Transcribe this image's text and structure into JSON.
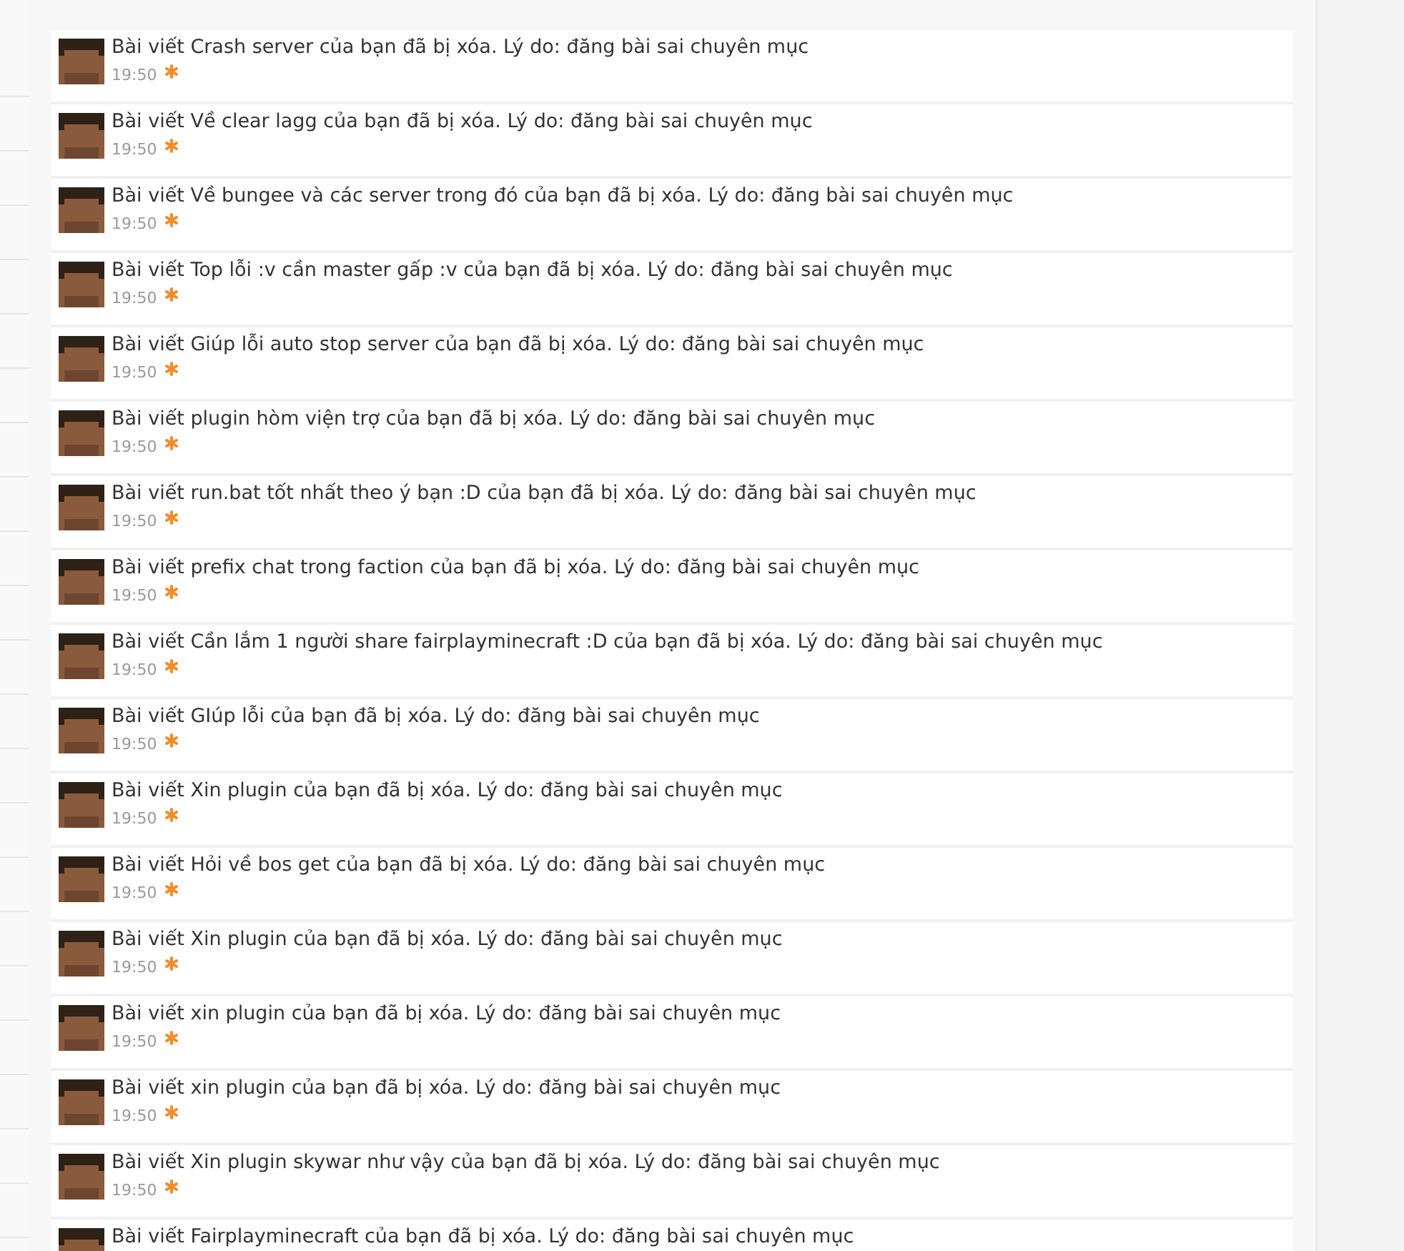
{
  "alerts": [
    {
      "text": "Bài viết Crash server của bạn đã bị xóa. Lý do: đăng bài sai chuyên mục",
      "time": "19:50",
      "unread": true
    },
    {
      "text": "Bài viết Về clear lagg của bạn đã bị xóa. Lý do: đăng bài sai chuyên mục",
      "time": "19:50",
      "unread": true
    },
    {
      "text": "Bài viết Về bungee và các server trong đó của bạn đã bị xóa. Lý do: đăng bài sai chuyên mục",
      "time": "19:50",
      "unread": true
    },
    {
      "text": "Bài viết Top lỗi :v cần master gấp :v của bạn đã bị xóa. Lý do: đăng bài sai chuyên mục",
      "time": "19:50",
      "unread": true
    },
    {
      "text": "Bài viết Giúp lỗi auto stop server của bạn đã bị xóa. Lý do: đăng bài sai chuyên mục",
      "time": "19:50",
      "unread": true
    },
    {
      "text": "Bài viết plugin hòm viện trợ của bạn đã bị xóa. Lý do: đăng bài sai chuyên mục",
      "time": "19:50",
      "unread": true
    },
    {
      "text": "Bài viết run.bat tốt nhất theo ý bạn :D của bạn đã bị xóa. Lý do: đăng bài sai chuyên mục",
      "time": "19:50",
      "unread": true
    },
    {
      "text": "Bài viết prefix chat trong faction của bạn đã bị xóa. Lý do: đăng bài sai chuyên mục",
      "time": "19:50",
      "unread": true
    },
    {
      "text": "Bài viết Cần lắm 1 người share fairplayminecraft :D của bạn đã bị xóa. Lý do: đăng bài sai chuyên mục",
      "time": "19:50",
      "unread": true
    },
    {
      "text": "Bài viết GIúp lỗi của bạn đã bị xóa. Lý do: đăng bài sai chuyên mục",
      "time": "19:50",
      "unread": true
    },
    {
      "text": "Bài viết Xin plugin của bạn đã bị xóa. Lý do: đăng bài sai chuyên mục",
      "time": "19:50",
      "unread": true
    },
    {
      "text": "Bài viết Hỏi về bos get của bạn đã bị xóa. Lý do: đăng bài sai chuyên mục",
      "time": "19:50",
      "unread": true
    },
    {
      "text": "Bài viết Xin plugin của bạn đã bị xóa. Lý do: đăng bài sai chuyên mục",
      "time": "19:50",
      "unread": true
    },
    {
      "text": "Bài viết xin plugin của bạn đã bị xóa. Lý do: đăng bài sai chuyên mục",
      "time": "19:50",
      "unread": true
    },
    {
      "text": "Bài viết xin plugin của bạn đã bị xóa. Lý do: đăng bài sai chuyên mục",
      "time": "19:50",
      "unread": true
    },
    {
      "text": "Bài viết Xin plugin skywar như vậy của bạn đã bị xóa. Lý do: đăng bài sai chuyên mục",
      "time": "19:50",
      "unread": true
    },
    {
      "text": "Bài viết Fairplayminecraft của bạn đã bị xóa. Lý do: đăng bài sai chuyên mục"
    }
  ]
}
